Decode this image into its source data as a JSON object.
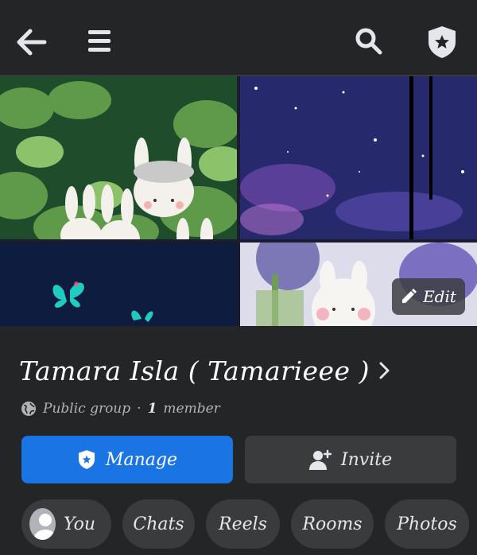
{
  "header": {
    "back_icon": "arrow-left-icon",
    "menu_icon": "hamburger-icon",
    "search_icon": "search-icon",
    "admin_icon": "shield-star-icon"
  },
  "cover": {
    "edit_label": "Edit"
  },
  "group": {
    "name": "Tamara Isla ( Tamarieee )",
    "privacy": "Public group",
    "separator": "·",
    "member_count": "1",
    "member_label": "member"
  },
  "actions": {
    "manage_label": "Manage",
    "invite_label": "Invite"
  },
  "tabs": [
    {
      "label": "You"
    },
    {
      "label": "Chats"
    },
    {
      "label": "Reels"
    },
    {
      "label": "Rooms"
    },
    {
      "label": "Photos"
    }
  ],
  "colors": {
    "background": "#242526",
    "primary": "#1b74e4",
    "chip": "#3a3b3c"
  }
}
